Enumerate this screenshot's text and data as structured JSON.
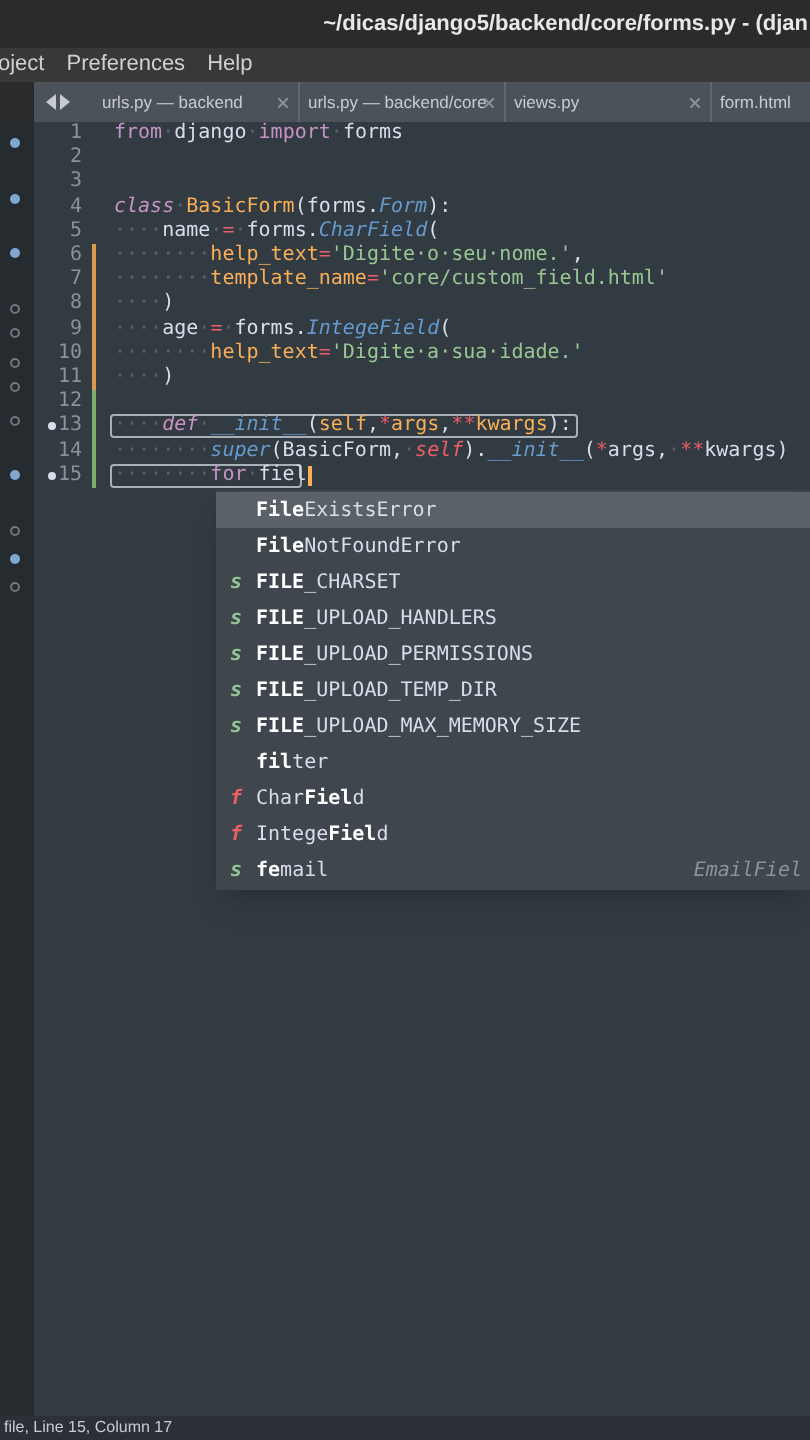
{
  "window": {
    "title": "~/dicas/django5/backend/core/forms.py - (djan"
  },
  "menu": [
    "oject",
    "Preferences",
    "Help"
  ],
  "tabs": [
    {
      "label": "urls.py — backend",
      "selected": false,
      "closable": true
    },
    {
      "label": "urls.py — backend/core",
      "selected": false,
      "closable": true
    },
    {
      "label": "views.py",
      "selected": false,
      "closable": true
    },
    {
      "label": "form.html",
      "selected": false,
      "closable": false
    }
  ],
  "sidebar": {
    "markers": [
      {
        "filled": true
      },
      {
        "filled": true
      },
      {
        "filled": true
      },
      {
        "filled": false
      },
      {
        "filled": false
      },
      {
        "filled": false
      },
      {
        "filled": false
      },
      {
        "filled": false
      },
      {
        "filled": true
      },
      {
        "filled": false
      },
      {
        "filled": true
      },
      {
        "filled": false
      }
    ]
  },
  "editor": {
    "lines": [
      {
        "number": "1",
        "modified": false,
        "added": false,
        "bookmark": false,
        "boxed": false,
        "tokens": [
          {
            "text": "from",
            "kind": "keyword"
          },
          {
            "text": "·",
            "kind": "ws"
          },
          {
            "text": "django",
            "kind": "plain"
          },
          {
            "text": "·",
            "kind": "ws"
          },
          {
            "text": "import",
            "kind": "keyword"
          },
          {
            "text": "·",
            "kind": "ws"
          },
          {
            "text": "forms",
            "kind": "plain"
          }
        ]
      },
      {
        "number": "2",
        "modified": false,
        "added": false,
        "bookmark": false,
        "boxed": false
      },
      {
        "number": "3",
        "modified": false,
        "added": false,
        "bookmark": false,
        "boxed": false
      },
      {
        "number": "4",
        "modified": false,
        "added": false,
        "bookmark": false,
        "boxed": false,
        "tokens": [
          {
            "text": "class",
            "kind": "storage"
          },
          {
            "text": "·",
            "kind": "ws"
          },
          {
            "text": "BasicForm",
            "kind": "class"
          },
          {
            "text": "(forms.",
            "kind": "plain"
          },
          {
            "text": "Form",
            "kind": "type"
          },
          {
            "text": "):",
            "kind": "plain"
          }
        ]
      },
      {
        "number": "5",
        "modified": false,
        "added": false,
        "bookmark": false,
        "boxed": false,
        "tokens": [
          {
            "text": "····",
            "kind": "ws"
          },
          {
            "text": "name",
            "kind": "plain"
          },
          {
            "text": "·",
            "kind": "ws"
          },
          {
            "text": "=",
            "kind": "operator"
          },
          {
            "text": "·",
            "kind": "ws"
          },
          {
            "text": "forms.",
            "kind": "plain"
          },
          {
            "text": "CharField",
            "kind": "type"
          },
          {
            "text": "(",
            "kind": "plain"
          }
        ]
      },
      {
        "number": "6",
        "modified": true,
        "added": false,
        "bookmark": false,
        "boxed": false,
        "tokens": [
          {
            "text": "········",
            "kind": "ws"
          },
          {
            "text": "help_text",
            "kind": "param"
          },
          {
            "text": "=",
            "kind": "operator"
          },
          {
            "text": "'Digite·o·seu·nome.'",
            "kind": "string"
          },
          {
            "text": ",",
            "kind": "plain"
          }
        ]
      },
      {
        "number": "7",
        "modified": true,
        "added": false,
        "bookmark": false,
        "boxed": false,
        "tokens": [
          {
            "text": "········",
            "kind": "ws"
          },
          {
            "text": "template_name",
            "kind": "param"
          },
          {
            "text": "=",
            "kind": "operator"
          },
          {
            "text": "'core/custom_field.html'",
            "kind": "string"
          }
        ]
      },
      {
        "number": "8",
        "modified": true,
        "added": false,
        "bookmark": false,
        "boxed": false,
        "tokens": [
          {
            "text": "····",
            "kind": "ws"
          },
          {
            "text": ")",
            "kind": "plain"
          }
        ]
      },
      {
        "number": "9",
        "modified": true,
        "added": false,
        "bookmark": false,
        "boxed": false,
        "tokens": [
          {
            "text": "····",
            "kind": "ws"
          },
          {
            "text": "age",
            "kind": "plain"
          },
          {
            "text": "·",
            "kind": "ws"
          },
          {
            "text": "=",
            "kind": "operator"
          },
          {
            "text": "·",
            "kind": "ws"
          },
          {
            "text": "forms.",
            "kind": "plain"
          },
          {
            "text": "IntegeField",
            "kind": "type"
          },
          {
            "text": "(",
            "kind": "plain"
          }
        ]
      },
      {
        "number": "10",
        "modified": true,
        "added": false,
        "bookmark": false,
        "boxed": false,
        "tokens": [
          {
            "text": "········",
            "kind": "ws"
          },
          {
            "text": "help_text",
            "kind": "param"
          },
          {
            "text": "=",
            "kind": "operator"
          },
          {
            "text": "'Digite·a·sua·idade.'",
            "kind": "string"
          }
        ]
      },
      {
        "number": "11",
        "modified": true,
        "added": false,
        "bookmark": false,
        "boxed": false,
        "tokens": [
          {
            "text": "····",
            "kind": "ws"
          },
          {
            "text": ")",
            "kind": "plain"
          }
        ]
      },
      {
        "number": "12",
        "modified": false,
        "added": true,
        "bookmark": false,
        "boxed": false
      },
      {
        "number": "13",
        "modified": false,
        "added": true,
        "bookmark": true,
        "boxed": true,
        "tokens": [
          {
            "text": "····",
            "kind": "ws"
          },
          {
            "text": "def",
            "kind": "storage"
          },
          {
            "text": "·",
            "kind": "ws"
          },
          {
            "text": "__init__",
            "kind": "function"
          },
          {
            "text": "(",
            "kind": "plain"
          },
          {
            "text": "self",
            "kind": "param"
          },
          {
            "text": ",",
            "kind": "plain"
          },
          {
            "text": "*",
            "kind": "operator"
          },
          {
            "text": "args",
            "kind": "param"
          },
          {
            "text": ",",
            "kind": "plain"
          },
          {
            "text": "**",
            "kind": "operator"
          },
          {
            "text": "kwargs",
            "kind": "param"
          },
          {
            "text": "):",
            "kind": "plain"
          }
        ]
      },
      {
        "number": "14",
        "modified": false,
        "added": true,
        "bookmark": false,
        "boxed": false,
        "tokens": [
          {
            "text": "········",
            "kind": "ws"
          },
          {
            "text": "super",
            "kind": "function"
          },
          {
            "text": "(BasicForm,",
            "kind": "plain"
          },
          {
            "text": "·",
            "kind": "ws"
          },
          {
            "text": "self",
            "kind": "self"
          },
          {
            "text": ").",
            "kind": "plain"
          },
          {
            "text": "__init__",
            "kind": "function"
          },
          {
            "text": "(",
            "kind": "plain"
          },
          {
            "text": "*",
            "kind": "operator"
          },
          {
            "text": "args,",
            "kind": "plain"
          },
          {
            "text": "·",
            "kind": "ws"
          },
          {
            "text": "**",
            "kind": "operator"
          },
          {
            "text": "kwargs)",
            "kind": "plain"
          }
        ]
      },
      {
        "number": "15",
        "modified": false,
        "added": true,
        "bookmark": true,
        "boxed": true,
        "cursor": true,
        "tokens": [
          {
            "text": "········",
            "kind": "ws"
          },
          {
            "text": "for",
            "kind": "keyword"
          },
          {
            "text": "·",
            "kind": "ws"
          },
          {
            "text": "fiel",
            "kind": "plain"
          }
        ]
      }
    ]
  },
  "completions": [
    {
      "label": "**File**ExistsError",
      "kind": "none",
      "selected": true
    },
    {
      "label": "**File**NotFoundError",
      "kind": "none",
      "selected": false
    },
    {
      "label": "**FILE**_CHARSET",
      "kind": "s",
      "selected": false
    },
    {
      "label": "**FILE**_UPLOAD_HANDLERS",
      "kind": "s",
      "selected": false
    },
    {
      "label": "**FILE**_UPLOAD_PERMISSIONS",
      "kind": "s",
      "selected": false
    },
    {
      "label": "**FILE**_UPLOAD_TEMP_DIR",
      "kind": "s",
      "selected": false
    },
    {
      "label": "**FILE**_UPLOAD_MAX_MEMORY_SIZE",
      "kind": "s",
      "selected": false
    },
    {
      "label": "**fil**ter",
      "kind": "none",
      "selected": false
    },
    {
      "label": "Char**Fiel**d",
      "kind": "f",
      "selected": false
    },
    {
      "label": "Intege**Fiel**d",
      "kind": "f",
      "selected": false
    },
    {
      "label": "**fe**mail",
      "kind": "s",
      "selected": false,
      "detail": "EmailFiel"
    }
  ],
  "status_bar": "file, Line 15, Column 17"
}
